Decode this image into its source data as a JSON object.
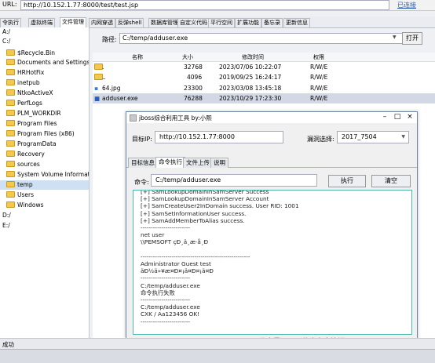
{
  "urlbar": {
    "label": "URL:",
    "value": "http://10.152.1.77:8000/test/test.jsp",
    "status_link": "已连接"
  },
  "tabs": [
    {
      "label": "令执行"
    },
    {
      "label": "虚拟终端"
    },
    {
      "label": "文件管理"
    },
    {
      "label": "内网穿透"
    },
    {
      "label": "反弹shell"
    },
    {
      "label": "数据库管理"
    },
    {
      "label": "自定义代码"
    },
    {
      "label": "平行空间"
    },
    {
      "label": "扩展功能"
    },
    {
      "label": "备忘录"
    },
    {
      "label": "更新信息"
    }
  ],
  "tree": [
    {
      "label": "A:/"
    },
    {
      "label": "C:/"
    },
    {
      "label": "$Recycle.Bin"
    },
    {
      "label": "Documents and Settings"
    },
    {
      "label": "HRHotFix"
    },
    {
      "label": "inetpub"
    },
    {
      "label": "NtkoActiveX"
    },
    {
      "label": "PerfLogs"
    },
    {
      "label": "PLM_WORKDIR"
    },
    {
      "label": "Program Files"
    },
    {
      "label": "Program Files (x86)"
    },
    {
      "label": "ProgramData"
    },
    {
      "label": "Recovery"
    },
    {
      "label": "sources"
    },
    {
      "label": "System Volume Information"
    },
    {
      "label": "temp"
    },
    {
      "label": "Users"
    },
    {
      "label": "Windows"
    },
    {
      "label": "D:/"
    },
    {
      "label": "E:/"
    }
  ],
  "path": {
    "label": "路径:",
    "value": "C:/temp/adduser.exe",
    "open_button": "打开"
  },
  "file_table": {
    "headers": [
      "名称",
      "大小",
      "修改时间",
      "权限"
    ],
    "rows": [
      {
        "name": ".",
        "size": "32768",
        "modified": "2023/07/06 10:22:07",
        "perm": "R/W/E"
      },
      {
        "name": "..",
        "size": "4096",
        "modified": "2019/09/25 16:24:17",
        "perm": "R/W/E"
      },
      {
        "name": "64.jpg",
        "size": "23300",
        "modified": "2023/03/08 13:45:18",
        "perm": "R/W/E"
      },
      {
        "name": "adduser.exe",
        "size": "76288",
        "modified": "2023/10/29 17:23:30",
        "perm": "R/W/E"
      }
    ]
  },
  "dialog": {
    "title": "jboss综合利用工具  by:小熙",
    "target_label": "目标IP:",
    "target_value": "http://10.152.1.77:8000",
    "vuln_label": "漏洞选择:",
    "vuln_value": "2017_7504",
    "tabs": [
      {
        "label": "目标信息"
      },
      {
        "label": "命令执行"
      },
      {
        "label": "文件上传"
      },
      {
        "label": "说明"
      }
    ],
    "cmd_label": "命令:",
    "cmd_value": "C:/temp/adduser.exe",
    "exec_button": "执行",
    "clear_button": "清空",
    "console_lines": [
      "[+] SamLookupDomainInSamServer Success",
      "[+] SamLookupDomainInSamServer Account",
      "[+] SamCreateUser2InDomain success. User RID: 1001",
      "[+] SamSetInformationUser success.",
      "[+] SamAddMemberToAlias success.",
      "------------------------",
      "net user",
      "\\\\PEMSOFT çÐ¸ä¸­æ·å¸Ð­",
      "",
      "-----------------------------------------------------",
      "Administrator            Guest                  test",
      "äÐ½ä»¥­æ¤Ð¤¡ä¤Ð¤¡ä¤Ð",
      "------------------------",
      "C:/temp/adduser.exe",
      "命令执行失败",
      "------------------------",
      "C:/temp/adduser.exe",
      "CXK / Aa123456 OK!",
      "------------------------"
    ]
  },
  "status_text": "成功",
  "watermark": "公众号 · Tim 信息安全笔记",
  "colors": {
    "selected_row": "#d2d8e4",
    "console_border": "#4db6ac",
    "folder": "#f2c94c",
    "link": "#2a5db0"
  }
}
